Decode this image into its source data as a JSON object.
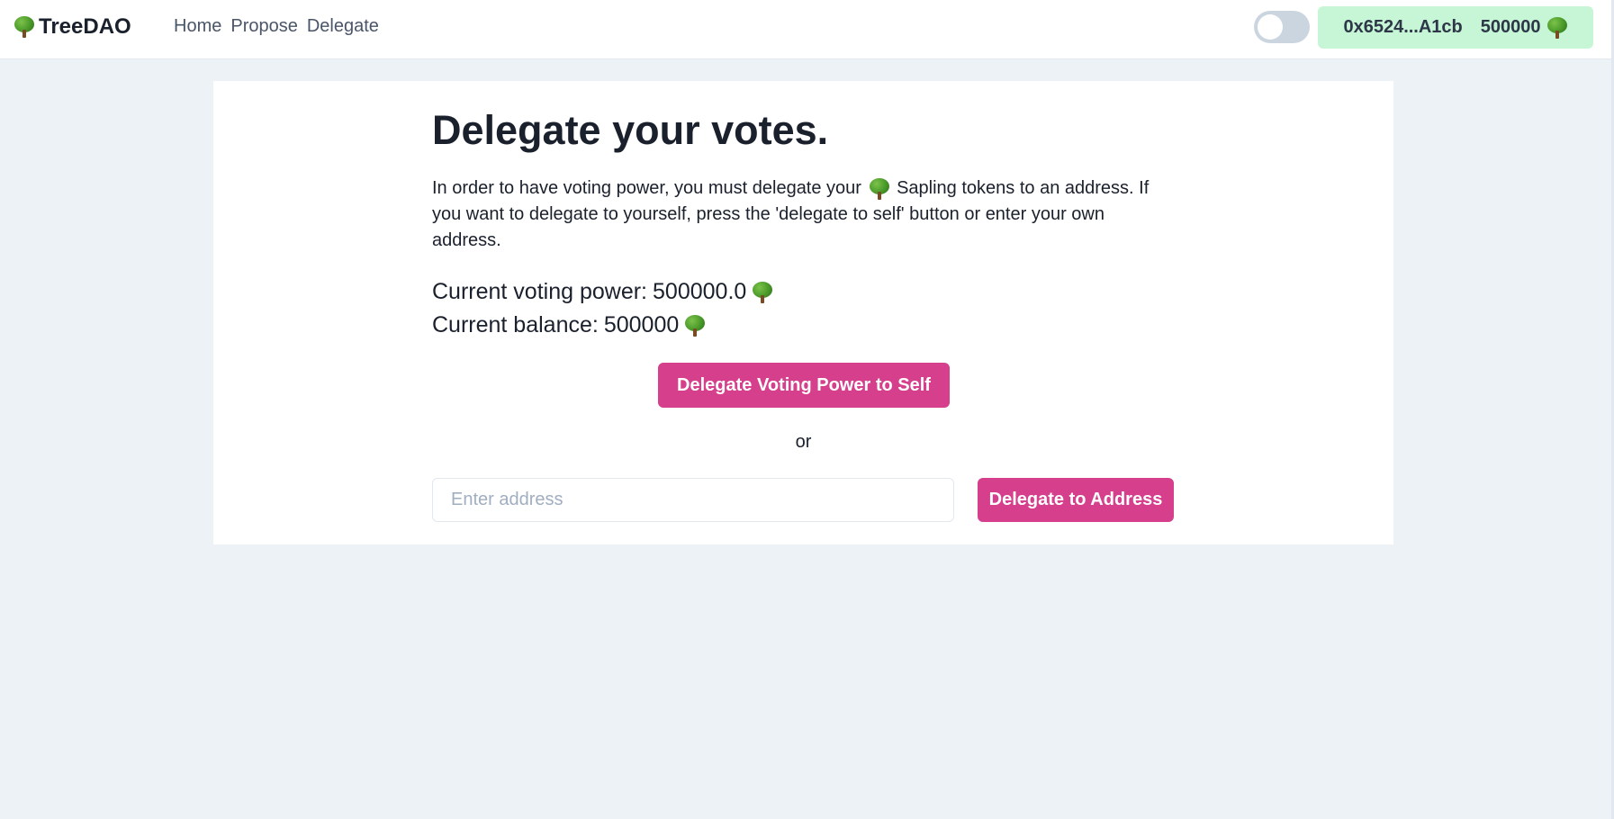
{
  "header": {
    "brand_name": "TreeDAO",
    "brand_icon": "tree-icon",
    "nav": [
      "Home",
      "Propose",
      "Delegate"
    ],
    "theme_toggle": {
      "checked": false
    },
    "account": {
      "address": "0x6524...A1cb",
      "balance": "500000",
      "token_icon": "tree-icon"
    }
  },
  "main": {
    "title": "Delegate your votes.",
    "description_before_icon": "In order to have voting power, you must delegate your",
    "description_after_icon": "Sapling tokens to an address. If you want to delegate to yourself, press the 'delegate to self' button or enter your own address.",
    "voting_power_label": "Current voting power:",
    "voting_power_value": "500000.0",
    "balance_label": "Current balance:",
    "balance_value": "500000",
    "self_button_label": "Delegate Voting Power to Self",
    "or_text": "or",
    "address_input": {
      "value": "",
      "placeholder": "Enter address"
    },
    "address_button_label": "Delegate to Address"
  },
  "colors": {
    "background": "#edf2f7",
    "card": "#ffffff",
    "accent_button": "#d53f8c",
    "account_pill": "#c6f6d5",
    "toggle_track": "#cbd5e0",
    "nav_text": "#4a5568"
  }
}
